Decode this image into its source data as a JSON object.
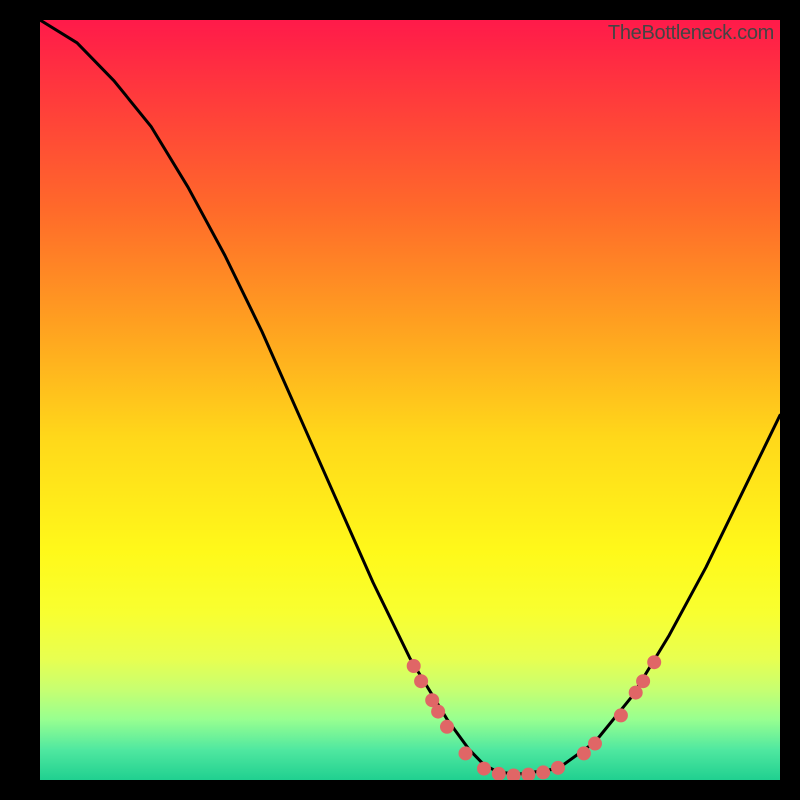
{
  "watermark": "TheBottleneck.com",
  "chart_data": {
    "type": "line",
    "title": "",
    "xlabel": "",
    "ylabel": "",
    "xlim": [
      0,
      100
    ],
    "ylim": [
      0,
      100
    ],
    "series": [
      {
        "name": "curve",
        "x": [
          0,
          5,
          10,
          15,
          20,
          25,
          30,
          35,
          40,
          45,
          50,
          55,
          58,
          60,
          62,
          65,
          70,
          75,
          80,
          85,
          90,
          95,
          100
        ],
        "y": [
          100,
          97,
          92,
          86,
          78,
          69,
          59,
          48,
          37,
          26,
          16,
          8,
          4,
          2,
          1,
          0.8,
          1.5,
          5,
          11,
          19,
          28,
          38,
          48
        ]
      }
    ],
    "markers": [
      {
        "x": 50.5,
        "y": 15
      },
      {
        "x": 51.5,
        "y": 13
      },
      {
        "x": 53.0,
        "y": 10.5
      },
      {
        "x": 53.8,
        "y": 9
      },
      {
        "x": 55.0,
        "y": 7
      },
      {
        "x": 57.5,
        "y": 3.5
      },
      {
        "x": 60.0,
        "y": 1.5
      },
      {
        "x": 62.0,
        "y": 0.8
      },
      {
        "x": 64.0,
        "y": 0.6
      },
      {
        "x": 66.0,
        "y": 0.7
      },
      {
        "x": 68.0,
        "y": 1.0
      },
      {
        "x": 70.0,
        "y": 1.6
      },
      {
        "x": 73.5,
        "y": 3.5
      },
      {
        "x": 75.0,
        "y": 4.8
      },
      {
        "x": 78.5,
        "y": 8.5
      },
      {
        "x": 80.5,
        "y": 11.5
      },
      {
        "x": 81.5,
        "y": 13
      },
      {
        "x": 83.0,
        "y": 15.5
      }
    ],
    "marker_color": "#e06666"
  }
}
